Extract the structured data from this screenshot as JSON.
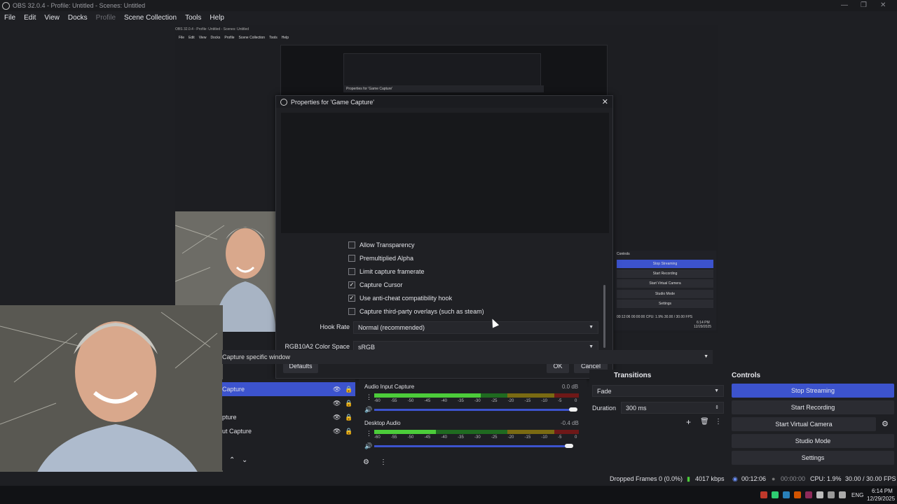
{
  "window": {
    "title": "OBS 32.0.4 - Profile: Untitled - Scenes: Untitled",
    "minimize": "—",
    "maximize": "❐",
    "close": "✕"
  },
  "menu": [
    "File",
    "Edit",
    "View",
    "Docks",
    "Profile",
    "Scene Collection",
    "Tools",
    "Help"
  ],
  "nested": {
    "title": "OBS 32.0.4 - Profile: Untitled - Scenes: Untitled",
    "menu": [
      "File",
      "Edit",
      "View",
      "Docks",
      "Profile",
      "Scene Collection",
      "Tools",
      "Help"
    ],
    "props_title": "Properties for 'Game Capture'",
    "controls_header": "Controls",
    "buttons": [
      "Stop Streaming",
      "Start Recording",
      "Start Virtual Camera",
      "Studio Mode",
      "Settings"
    ],
    "status": "00:12:06   00:00:00   CPU: 1.9%   30.00 / 30.00 FPS",
    "clock_time": "6:14 PM",
    "clock_date": "12/29/2025"
  },
  "dialog": {
    "title": "Properties for 'Game Capture'",
    "close": "✕",
    "checkboxes": [
      {
        "label": "Allow Transparency",
        "checked": false
      },
      {
        "label": "Premultiplied Alpha",
        "checked": false
      },
      {
        "label": "Limit capture framerate",
        "checked": false
      },
      {
        "label": "Capture Cursor",
        "checked": true
      },
      {
        "label": "Use anti-cheat compatibility hook",
        "checked": true
      },
      {
        "label": "Capture third-party overlays (such as steam)",
        "checked": false
      }
    ],
    "hook_rate_label": "Hook Rate",
    "hook_rate_value": "Normal (recommended)",
    "color_space_label": "RGB10A2 Color Space",
    "color_space_value": "sRGB",
    "defaults": "Defaults",
    "ok": "OK",
    "cancel": "Cancel",
    "check_mark": "✓"
  },
  "capture_mode": "Capture specific window",
  "sources": [
    {
      "label": "Game Capture",
      "selected": true
    },
    {
      "label": "",
      "selected": false
    },
    {
      "label": "Window Capture",
      "selected": false
    },
    {
      "label": "Input Capture",
      "selected": false
    }
  ],
  "sources_visible_text": [
    "Capture",
    "",
    "pture",
    "ut Capture"
  ],
  "mixer": {
    "channels": [
      {
        "name": "Audio Input Capture",
        "db": "0.0 dB",
        "level": 0.52
      },
      {
        "name": "Desktop Audio",
        "db": "-0.4 dB",
        "level": 0.3
      }
    ],
    "scale": [
      "-60",
      "-55",
      "-50",
      "-45",
      "-40",
      "-35",
      "-30",
      "-25",
      "-20",
      "-15",
      "-10",
      "-5",
      "0"
    ]
  },
  "transitions": {
    "header": "Transitions",
    "type": "Fade",
    "duration_label": "Duration",
    "duration_value": "300 ms"
  },
  "controls": {
    "header": "Controls",
    "buttons": [
      "Stop Streaming",
      "Start Recording",
      "Start Virtual Camera",
      "Studio Mode",
      "Settings"
    ]
  },
  "status": {
    "dropped": "Dropped Frames 0 (0.0%)",
    "bitrate": "4017 kbps",
    "stream_time": "00:12:06",
    "rec_time": "00:00:00",
    "cpu": "CPU: 1.9%",
    "fps": "30.00 / 30.00 FPS"
  },
  "taskbar": {
    "lang": "ENG",
    "time": "6:14 PM",
    "date": "12/29/2025"
  },
  "colors": {
    "accent": "#3c53cd",
    "meter_green": "#4ccc3a"
  }
}
